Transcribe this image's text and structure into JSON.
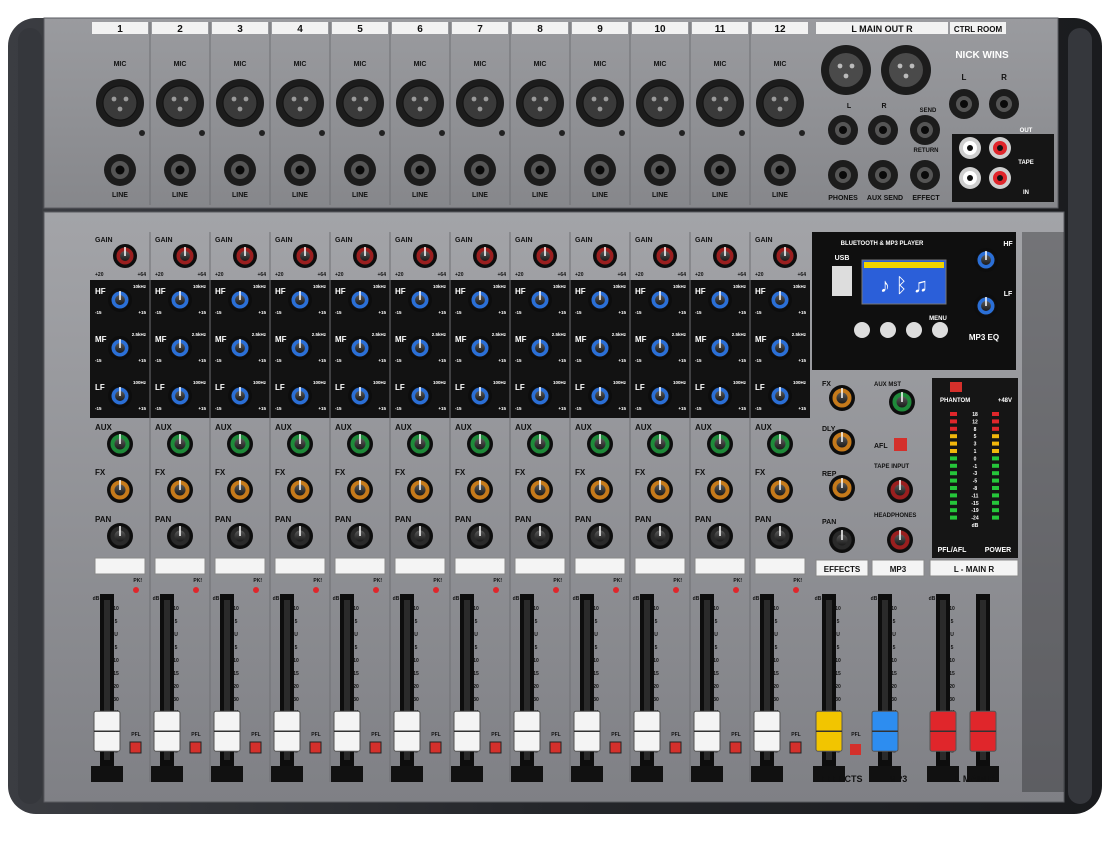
{
  "brand": "NICK WINS",
  "channels": [
    "1",
    "2",
    "3",
    "4",
    "5",
    "6",
    "7",
    "8",
    "9",
    "10",
    "11",
    "12"
  ],
  "labels": {
    "mic": "MIC",
    "line": "LINE",
    "gain": "GAIN",
    "hf": "HF",
    "mf": "MF",
    "lf": "LF",
    "aux": "AUX",
    "fx": "FX",
    "pan": "PAN",
    "pk": "PK!",
    "pfl": "PFL",
    "db": "dB",
    "hf_freq": "10kHz",
    "mf_freq": "2.5kHz",
    "lf_freq": "100Hz",
    "eq_range_low": "-15",
    "eq_range_high": "+15",
    "gain_range_low": "+20",
    "gain_range_high": "+64"
  },
  "top_right": {
    "main_out": "L  MAIN OUT  R",
    "ctrl_room": "CTRL ROOM",
    "l": "L",
    "r": "R",
    "send": "SEND",
    "return": "RETURN",
    "phones": "PHONES",
    "aux_send": "AUX SEND",
    "effect": "EFFECT",
    "out": "OUT",
    "tape": "TAPE",
    "in": "IN"
  },
  "player": {
    "title": "BLUETOOTH & MP3 PLAYER",
    "usb": "USB",
    "menu": "MENU",
    "eq_label": "MP3 EQ",
    "hf": "HF",
    "lf": "LF"
  },
  "effects_section": {
    "fx": "FX",
    "dly": "DLY",
    "rep": "REP",
    "pan": "PAN",
    "strip_label": "EFFECTS",
    "fader_label": "EFFECTS",
    "pfl": "PFL"
  },
  "mp3_section": {
    "aux_mst": "AUX MST",
    "afl": "AFL",
    "tape_input": "TAPE INPUT",
    "headphones": "HEADPHONES",
    "strip_label": "MP3",
    "fader_label": "MP3"
  },
  "main_section": {
    "phantom": "PHANTOM",
    "plus48v": "+48V",
    "pfl_afl": "PFL/AFL",
    "power": "POWER",
    "strip_label": "L - MAIN  R",
    "fader_label": "L  MAIN  R",
    "meter_scale": [
      "18",
      "12",
      "8",
      "5",
      "3",
      "1",
      "0",
      "-1",
      "-3",
      "-5",
      "-8",
      "-11",
      "-15",
      "-19",
      "-24",
      "dB"
    ]
  },
  "fader_scale": [
    "10",
    "5",
    "U",
    "5",
    "10",
    "15",
    "20",
    "30",
    "40",
    "50",
    "60",
    "∞"
  ],
  "colors": {
    "chassis": "#2b2d31",
    "panel": "#8c8d91",
    "eq_panel": "#121212",
    "gain_knob": "#9a1f1f",
    "eq_knob": "#2b6fd6",
    "aux_knob": "#1f8a3a",
    "fx_knob": "#c57a1b",
    "pan_knob": "#2a2a2a",
    "effects_cap": "#f2c500",
    "mp3_cap": "#2d8df0",
    "main_cap": "#e0262b",
    "channel_cap": "#f4f4f4"
  },
  "fader_levels": {
    "channels": [
      0.08,
      0.08,
      0.08,
      0.08,
      0.08,
      0.08,
      0.08,
      0.08,
      0.08,
      0.08,
      0.08,
      0.08
    ],
    "effects": 0.08,
    "mp3": 0.08,
    "main_l": 0.08,
    "main_r": 0.08
  }
}
